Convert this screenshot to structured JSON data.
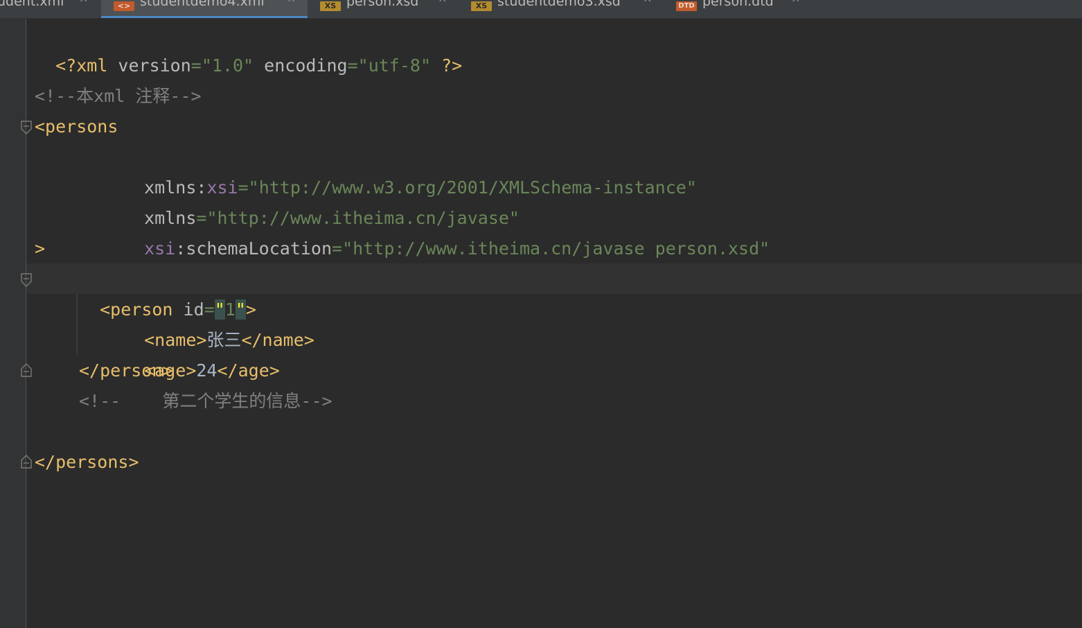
{
  "tabs": [
    {
      "label": "udent.xml",
      "badge": ""
    },
    {
      "label": "studentdemo4.xml",
      "badge": "<>",
      "active": true
    },
    {
      "label": "person.xsd",
      "badge": "XS"
    },
    {
      "label": "studentdemo3.xsd",
      "badge": "XS"
    },
    {
      "label": "person.dtd",
      "badge": "DTD"
    }
  ],
  "close_glyph": "×",
  "code": {
    "l1": {
      "p1": "<?xml ",
      "p2": "version",
      "p3": "=",
      "p4": "\"1.0\"",
      "p5": " encoding",
      "p6": "=",
      "p7": "\"utf-8\"",
      "p8": " ?>"
    },
    "l3": "<!--本xml 注释-->",
    "l4": "<persons",
    "l5": {
      "p1": "xmlns",
      "p2": ":",
      "p3": "xsi",
      "p4": "=",
      "p5": "\"http://www.w3.org/2001/XMLSchema-instance\""
    },
    "l6": {
      "p1": "xmlns",
      "p2": "=",
      "p3": "\"http://www.itheima.cn/javase\""
    },
    "l7": {
      "p1": "xsi",
      "p2": ":schemaLocation",
      "p3": "=",
      "p4": "\"http://www.itheima.cn/javase person.xsd\""
    },
    "l8": ">",
    "l9": {
      "p1": "<person ",
      "p2": "id",
      "p3": "=",
      "p4": "\"",
      "p5": "1",
      "p6": "\"",
      "p7": ">"
    },
    "l10": {
      "p1": "<name>",
      "p2": "张三",
      "p3": "</name>"
    },
    "l11": {
      "p1": "<age>",
      "p2": "24",
      "p3": "</age>"
    },
    "l12": "</person>",
    "l13": "<!--    第二个学生的信息-->",
    "l15": "</persons>"
  },
  "colors": {
    "tag": "#e8bf6a",
    "attr": "#bababa",
    "value": "#6a8759",
    "namespace": "#9876aa",
    "comment": "#808080",
    "accent": "#4a88c7"
  }
}
